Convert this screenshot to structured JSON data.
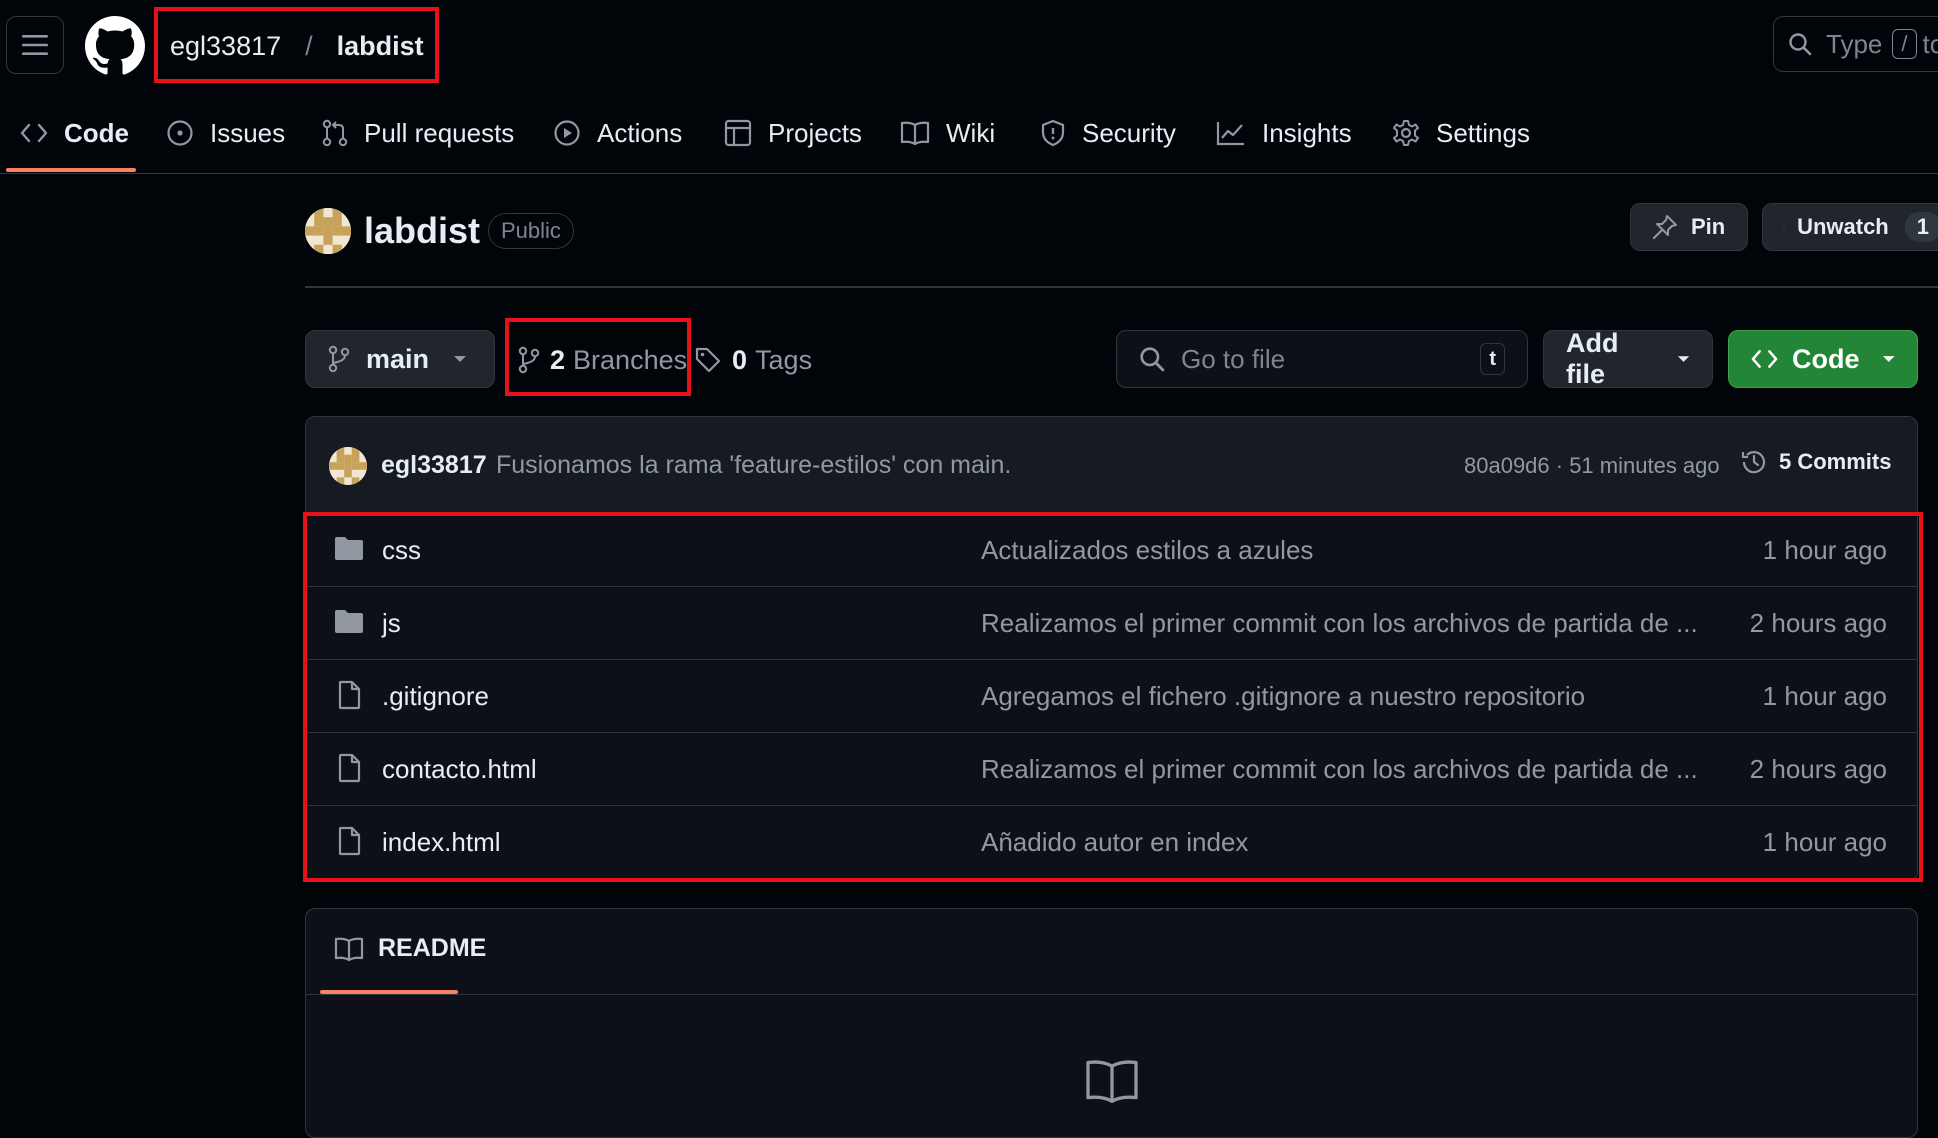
{
  "header": {
    "owner": "egl33817",
    "separator": "/",
    "repo": "labdist",
    "search_placeholder": "Type",
    "search_shortcut": "/",
    "search_trailing": "to"
  },
  "nav": {
    "tabs": [
      {
        "label": "Code",
        "icon": "code-icon",
        "active": true
      },
      {
        "label": "Issues",
        "icon": "issue-icon"
      },
      {
        "label": "Pull requests",
        "icon": "pull-request-icon"
      },
      {
        "label": "Actions",
        "icon": "play-icon"
      },
      {
        "label": "Projects",
        "icon": "table-icon"
      },
      {
        "label": "Wiki",
        "icon": "book-icon"
      },
      {
        "label": "Security",
        "icon": "shield-icon"
      },
      {
        "label": "Insights",
        "icon": "graph-icon"
      },
      {
        "label": "Settings",
        "icon": "gear-icon"
      }
    ]
  },
  "repo": {
    "name": "labdist",
    "visibility": "Public",
    "pin_label": "Pin",
    "unwatch_label": "Unwatch",
    "watch_count": "1"
  },
  "toolbar": {
    "branch": "main",
    "branches_count": "2",
    "branches_label": "Branches",
    "tags_count": "0",
    "tags_label": "Tags",
    "goto_placeholder": "Go to file",
    "goto_shortcut": "t",
    "add_file_label": "Add file",
    "code_label": "Code"
  },
  "commit": {
    "author": "egl33817",
    "message": "Fusionamos la rama 'feature-estilos' con main.",
    "sha_time": "80a09d6 · 51 minutes ago",
    "commits_label": "5 Commits"
  },
  "files": [
    {
      "name": "css",
      "type": "folder",
      "message": "Actualizados estilos a azules",
      "time": "1 hour ago"
    },
    {
      "name": "js",
      "type": "folder",
      "message": "Realizamos el primer commit con los archivos de partida de ...",
      "time": "2 hours ago"
    },
    {
      "name": ".gitignore",
      "type": "file",
      "message": "Agregamos el fichero .gitignore a nuestro repositorio",
      "time": "1 hour ago"
    },
    {
      "name": "contacto.html",
      "type": "file",
      "message": "Realizamos el primer commit con los archivos de partida de ...",
      "time": "2 hours ago"
    },
    {
      "name": "index.html",
      "type": "file",
      "message": "Añadido autor en index",
      "time": "1 hour ago"
    }
  ],
  "readme": {
    "tab_label": "README"
  },
  "colors": {
    "background": "#010409",
    "surface": "#0d1117",
    "border": "#30363d",
    "accent_underline": "#f78166",
    "code_button": "#238636",
    "highlight_box": "#e3121b"
  }
}
